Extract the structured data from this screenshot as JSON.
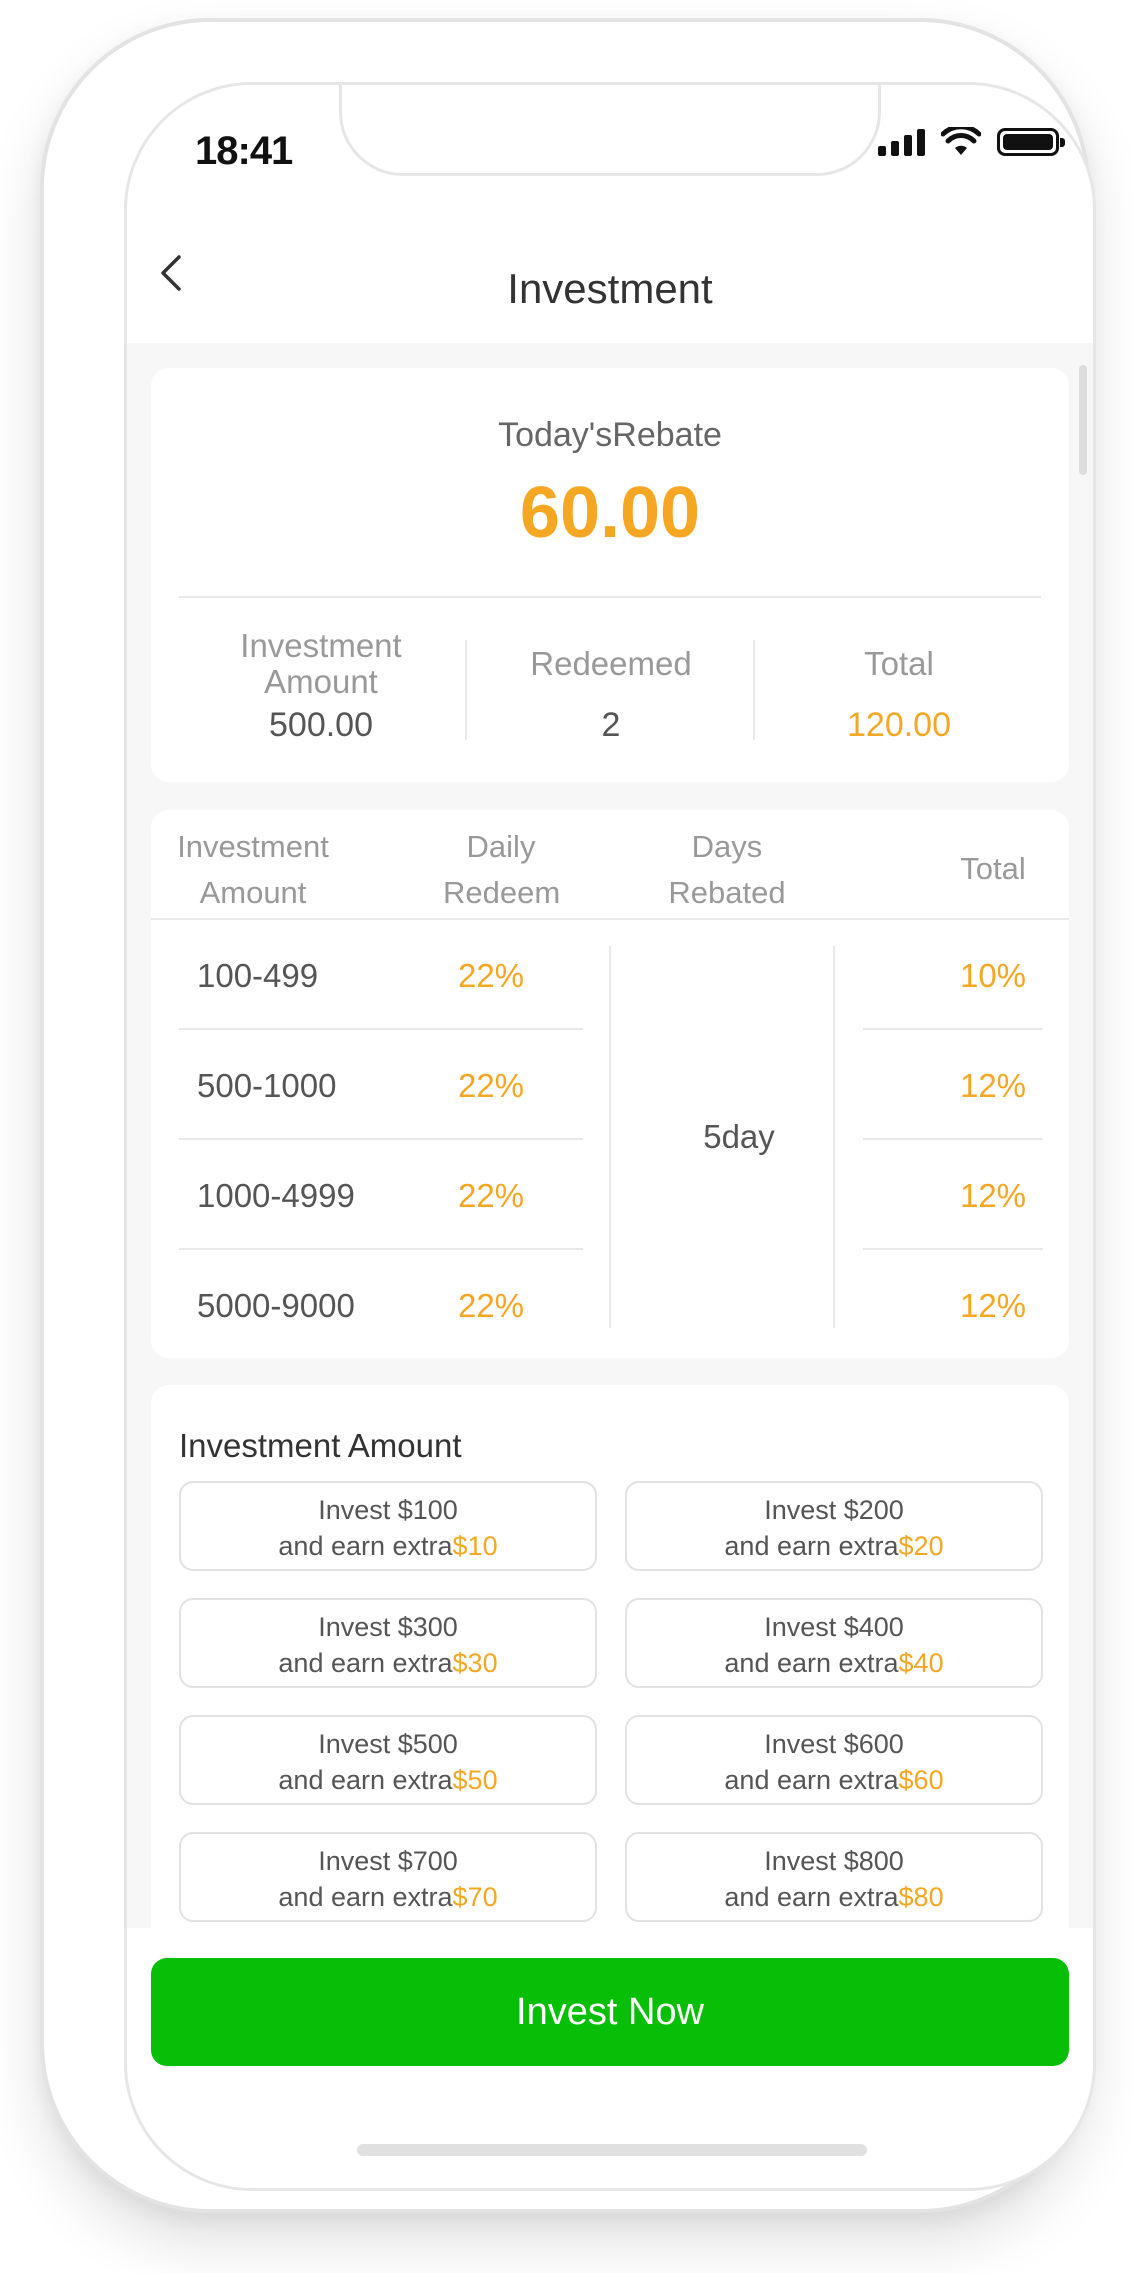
{
  "status_bar": {
    "time": "18:41"
  },
  "header": {
    "title": "Investment"
  },
  "rebate": {
    "label": "Today'sRebate",
    "value": "60.00",
    "stats": [
      {
        "label": "Investment Amount",
        "value": "500.00"
      },
      {
        "label": "Redeemed",
        "value": "2"
      },
      {
        "label": "Total",
        "value": "120.00"
      }
    ]
  },
  "rebate_table": {
    "headers": [
      "Investment Amount",
      "Daily Redeem",
      "Days Rebated",
      "Total"
    ],
    "days_rebated": "5day",
    "rows": [
      {
        "range": "100-499",
        "daily": "22%",
        "total": "10%"
      },
      {
        "range": "500-1000",
        "daily": "22%",
        "total": "12%"
      },
      {
        "range": "1000-4999",
        "daily": "22%",
        "total": "12%"
      },
      {
        "range": "5000-9000",
        "daily": "22%",
        "total": "12%"
      }
    ]
  },
  "investment_options": {
    "title": "Investment Amount",
    "options": [
      {
        "line1": "Invest $100",
        "line2": "and earn extra",
        "extra": "$10"
      },
      {
        "line1": "Invest $200",
        "line2": "and earn extra",
        "extra": "$20"
      },
      {
        "line1": "Invest $300",
        "line2": "and earn extra",
        "extra": "$30"
      },
      {
        "line1": "Invest $400",
        "line2": "and earn extra",
        "extra": "$40"
      },
      {
        "line1": "Invest $500",
        "line2": "and earn extra",
        "extra": "$50"
      },
      {
        "line1": "Invest $600",
        "line2": "and earn extra",
        "extra": "$60"
      },
      {
        "line1": "Invest $700",
        "line2": "and earn extra",
        "extra": "$70"
      },
      {
        "line1": "Invest $800",
        "line2": "and earn extra",
        "extra": "$80"
      }
    ]
  },
  "footer": {
    "invest_button": "Invest Now"
  },
  "colors": {
    "accent": "#f5a623",
    "primary_button": "#07bf07"
  },
  "icons": [
    "back-arrow-icon",
    "signal-icon",
    "wifi-icon",
    "battery-icon"
  ]
}
